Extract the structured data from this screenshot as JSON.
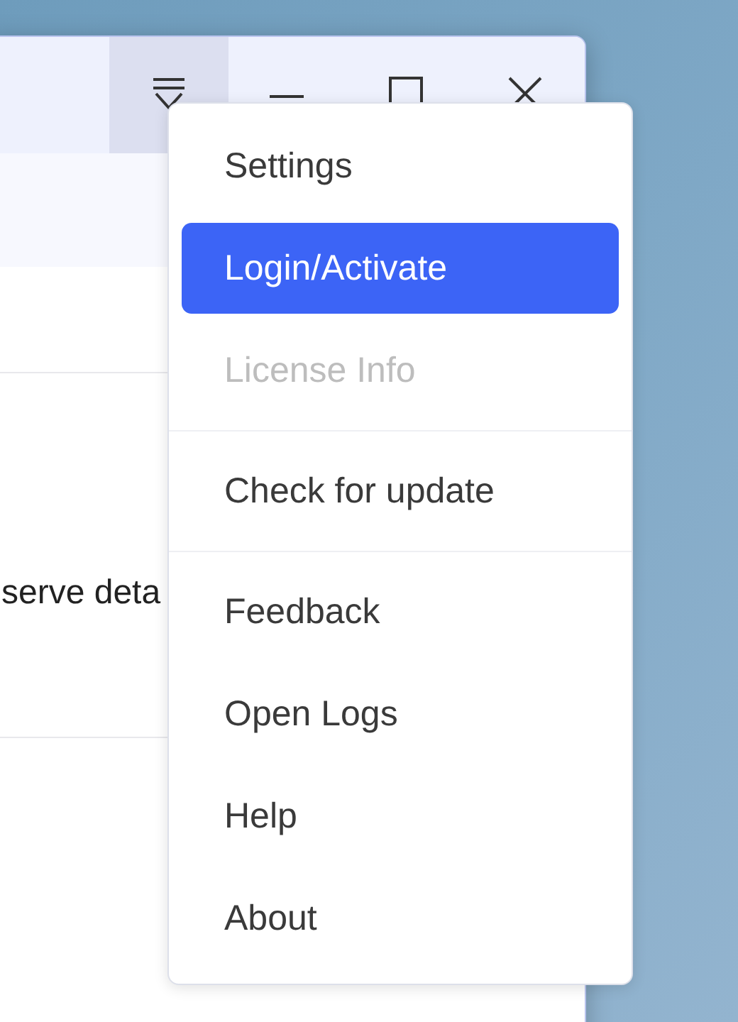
{
  "window": {
    "title_bar": {
      "buttons": [
        {
          "kind": "menu",
          "pressed": true
        },
        {
          "kind": "minimize",
          "pressed": false
        },
        {
          "kind": "maximize",
          "pressed": false
        },
        {
          "kind": "close",
          "pressed": false
        }
      ]
    },
    "content": {
      "text": "serve deta"
    }
  },
  "menu": {
    "groups": [
      [
        {
          "label": "Settings",
          "selected": false,
          "disabled": false
        },
        {
          "label": "Login/Activate",
          "selected": true,
          "disabled": false
        },
        {
          "label": "License Info",
          "selected": false,
          "disabled": true
        }
      ],
      [
        {
          "label": "Check for update",
          "selected": false,
          "disabled": false
        }
      ],
      [
        {
          "label": "Feedback",
          "selected": false,
          "disabled": false
        },
        {
          "label": "Open Logs",
          "selected": false,
          "disabled": false
        },
        {
          "label": "Help",
          "selected": false,
          "disabled": false
        },
        {
          "label": "About",
          "selected": false,
          "disabled": false
        }
      ]
    ]
  }
}
